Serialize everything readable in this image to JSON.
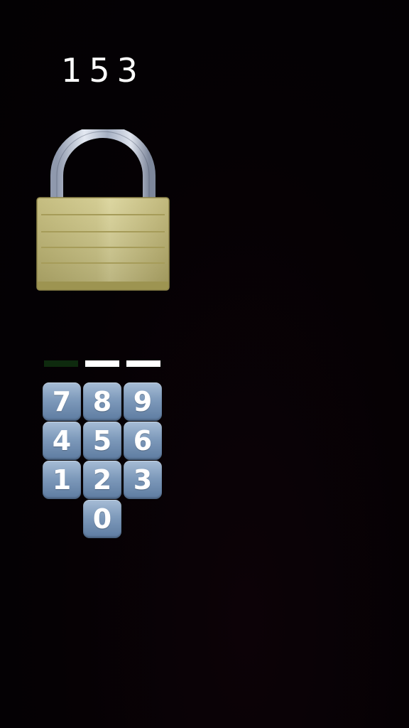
{
  "display": {
    "code": "153"
  },
  "padlock": {
    "icon": "padlock-icon",
    "body_color": "#c9c07c",
    "shackle_color": "#b9c3d6"
  },
  "entry": {
    "digits_entered": 1,
    "total_digits": 3,
    "filled_color": "#0e2a0e",
    "empty_color": "#ffffff"
  },
  "keypad": {
    "keys": [
      {
        "label": "7"
      },
      {
        "label": "8"
      },
      {
        "label": "9"
      },
      {
        "label": "4"
      },
      {
        "label": "5"
      },
      {
        "label": "6"
      },
      {
        "label": "1"
      },
      {
        "label": "2"
      },
      {
        "label": "3"
      },
      {
        "label": "0"
      }
    ],
    "key_color": "#7e9abb"
  }
}
